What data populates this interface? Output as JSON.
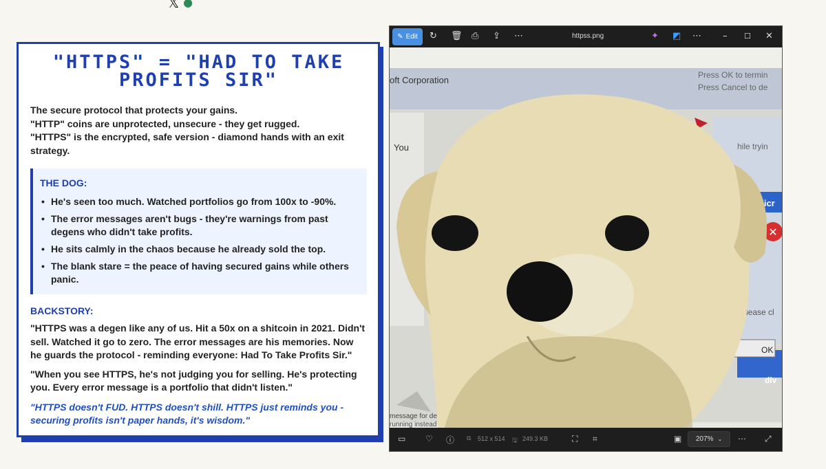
{
  "card": {
    "title": "\"HTTPS\" = \"HAD TO TAKE PROFITS SIR\"",
    "intro": [
      "The secure protocol that protects your gains.",
      "\"HTTP\" coins are unprotected, unsecure - they get rugged.",
      "\"HTTPS\" is the encrypted, safe version - diamond hands with an exit strategy."
    ],
    "dog": {
      "heading": "THE DOG:",
      "items": [
        "He's seen too much. Watched portfolios go from 100x to -90%.",
        "The error messages aren't bugs - they're warnings from past degens who didn't take profits.",
        "He sits calmly in the chaos because he already sold the top.",
        "The blank stare = the peace of having secured gains while others panic."
      ]
    },
    "backstory": {
      "heading": "BACKSTORY:",
      "paragraphs": [
        "\"HTTPS was a degen like any of us. Hit a 50x on a shitcoin in 2021. Didn't sell. Watched it go to zero. The error messages are his memories. Now he guards the protocol - reminding everyone: Had To Take Profits Sir.\"",
        "\"When you see HTTPS, he's not judging you for selling. He's protecting you. Every error message is a portfolio that didn't listen.\""
      ],
      "quote": "\"HTTPS doesn't FUD. HTTPS doesn't shill. HTTPS just reminds you - securing profits isn't paper hands, it's wisdom.\""
    }
  },
  "viewer": {
    "edit_label": "Edit",
    "filename": "httpss.png",
    "dimensions": "512 x 514",
    "filesize": "249.3 KB",
    "zoom": "207%",
    "image_text": {
      "corp": "oft Corporation",
      "press_ok": "Press OK to termin",
      "press_cancel": "Press Cancel to de",
      "you": "You",
      "while": "hile tryin",
      "micr": "Micr",
      "please": "Please cl",
      "ok": "OK",
      "div": "div",
      "message": "message for deta",
      "running": "running instead"
    }
  },
  "colors": {
    "accent_blue": "#1f3fae",
    "dog_box_bg": "#eef4ff",
    "edit_button": "#4a90e2",
    "window_bg": "#202020"
  }
}
